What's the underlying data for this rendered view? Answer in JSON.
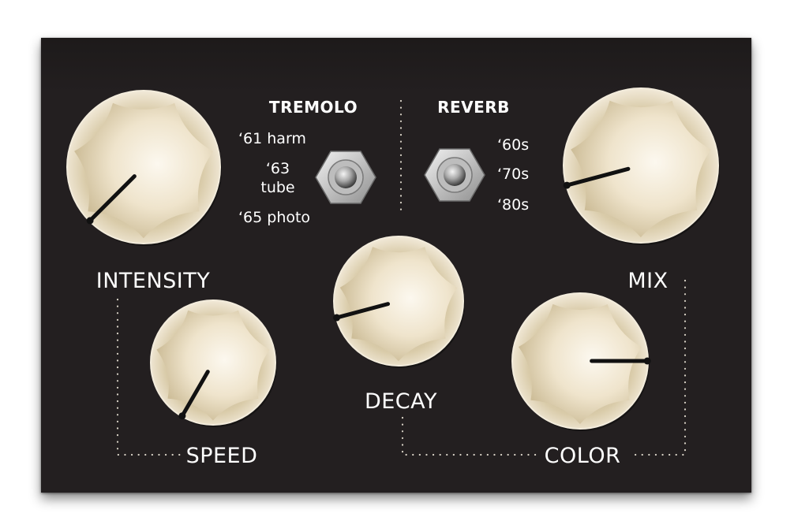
{
  "colors": {
    "panel": "#231f20",
    "knob_light": "#fbf6ec",
    "knob_mid": "#e9dcc2",
    "knob_dark": "#a7997a",
    "pointer": "#111111",
    "label": "#ffffff",
    "dots": "#d8d2c6"
  },
  "knobs": {
    "intensity": {
      "label": "INTENSITY",
      "level": 0.05
    },
    "speed": {
      "label": "SPEED",
      "level": 0.0
    },
    "decay": {
      "label": "DECAY",
      "level": 0.15
    },
    "mix": {
      "label": "MIX",
      "level": 0.15
    },
    "color": {
      "label": "COLOR",
      "level": 0.8
    }
  },
  "tremolo": {
    "title": "TREMOLO",
    "options": [
      "‘61 harm",
      "‘63",
      "tube",
      "‘65 photo"
    ]
  },
  "reverb": {
    "title": "REVERB",
    "options": [
      "‘60s",
      "‘70s",
      "‘80s"
    ]
  }
}
